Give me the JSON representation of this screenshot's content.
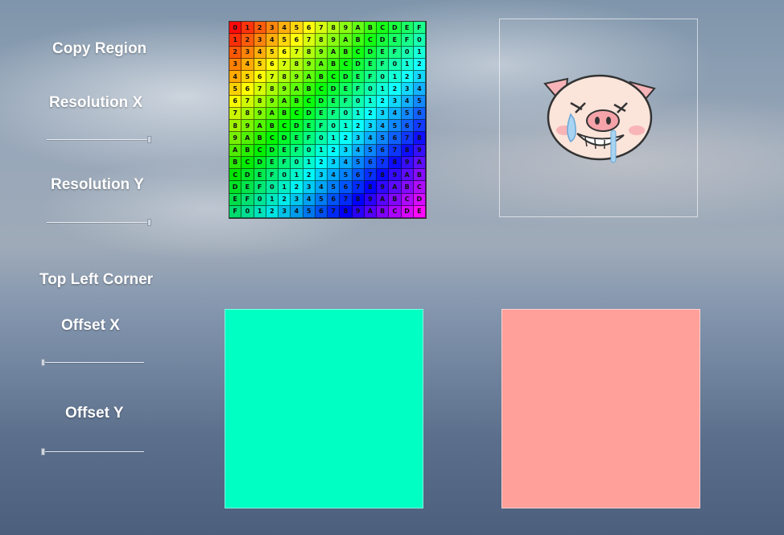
{
  "controls": {
    "copy_region_label": "Copy Region",
    "resolution_x_label": "Resolution X",
    "resolution_y_label": "Resolution Y",
    "top_left_corner_label": "Top Left Corner",
    "offset_x_label": "Offset X",
    "offset_y_label": "Offset Y",
    "resolution_x_value": 1.0,
    "resolution_y_value": 1.0,
    "offset_x_value": 0.0,
    "offset_y_value": 0.0
  },
  "source_texture": {
    "glyphs": [
      "0",
      "1",
      "2",
      "3",
      "4",
      "5",
      "6",
      "7",
      "8",
      "9",
      "A",
      "B",
      "C",
      "D",
      "E",
      "F"
    ],
    "grid_size": 16,
    "style": "rainbow-hex-grid"
  },
  "preview_image": {
    "icon": "crying-pig-icon"
  },
  "output_swatches": [
    {
      "name": "copy-output-swatch",
      "color": "#00ffc3"
    },
    {
      "name": "reference-swatch",
      "color": "#ffa09a"
    }
  ]
}
